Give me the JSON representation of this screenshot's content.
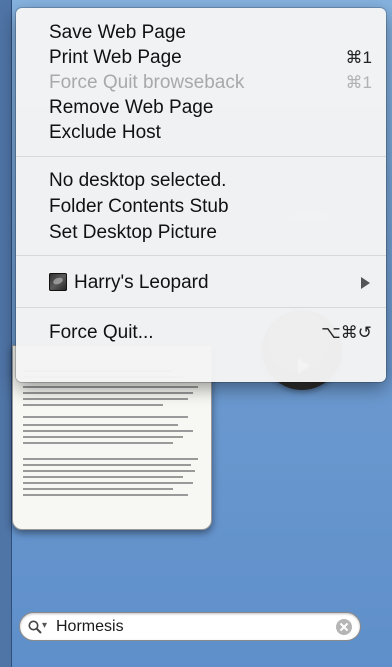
{
  "menu": {
    "items": [
      {
        "label": "Save Web Page",
        "shortcut": "",
        "enabled": true
      },
      {
        "label": "Print Web Page",
        "shortcut": "⌘1",
        "enabled": true
      },
      {
        "label": "Force Quit browseback",
        "shortcut": "⌘1",
        "enabled": false
      },
      {
        "label": "Remove Web Page",
        "shortcut": "",
        "enabled": true
      },
      {
        "label": "Exclude Host",
        "shortcut": "",
        "enabled": true
      }
    ],
    "desktop_section": [
      {
        "label": "No desktop selected."
      },
      {
        "label": "Folder Contents Stub"
      },
      {
        "label": "Set Desktop Picture"
      }
    ],
    "submenu": {
      "label": "Harry's Leopard"
    },
    "force_quit": {
      "label": "Force Quit...",
      "shortcut": "⌥⌘↺"
    }
  },
  "search": {
    "value": "Hormesis"
  },
  "icons": {
    "submenu": "chevron-right-icon",
    "search": "magnifier-icon",
    "clear": "clear-icon",
    "desktop_thumbnail": "leopard-thumbnail-icon"
  },
  "colors": {
    "desktop_blue": "#6f9fd3",
    "menu_bg": "#f4f4f4",
    "disabled_text": "#a9a9a9"
  }
}
